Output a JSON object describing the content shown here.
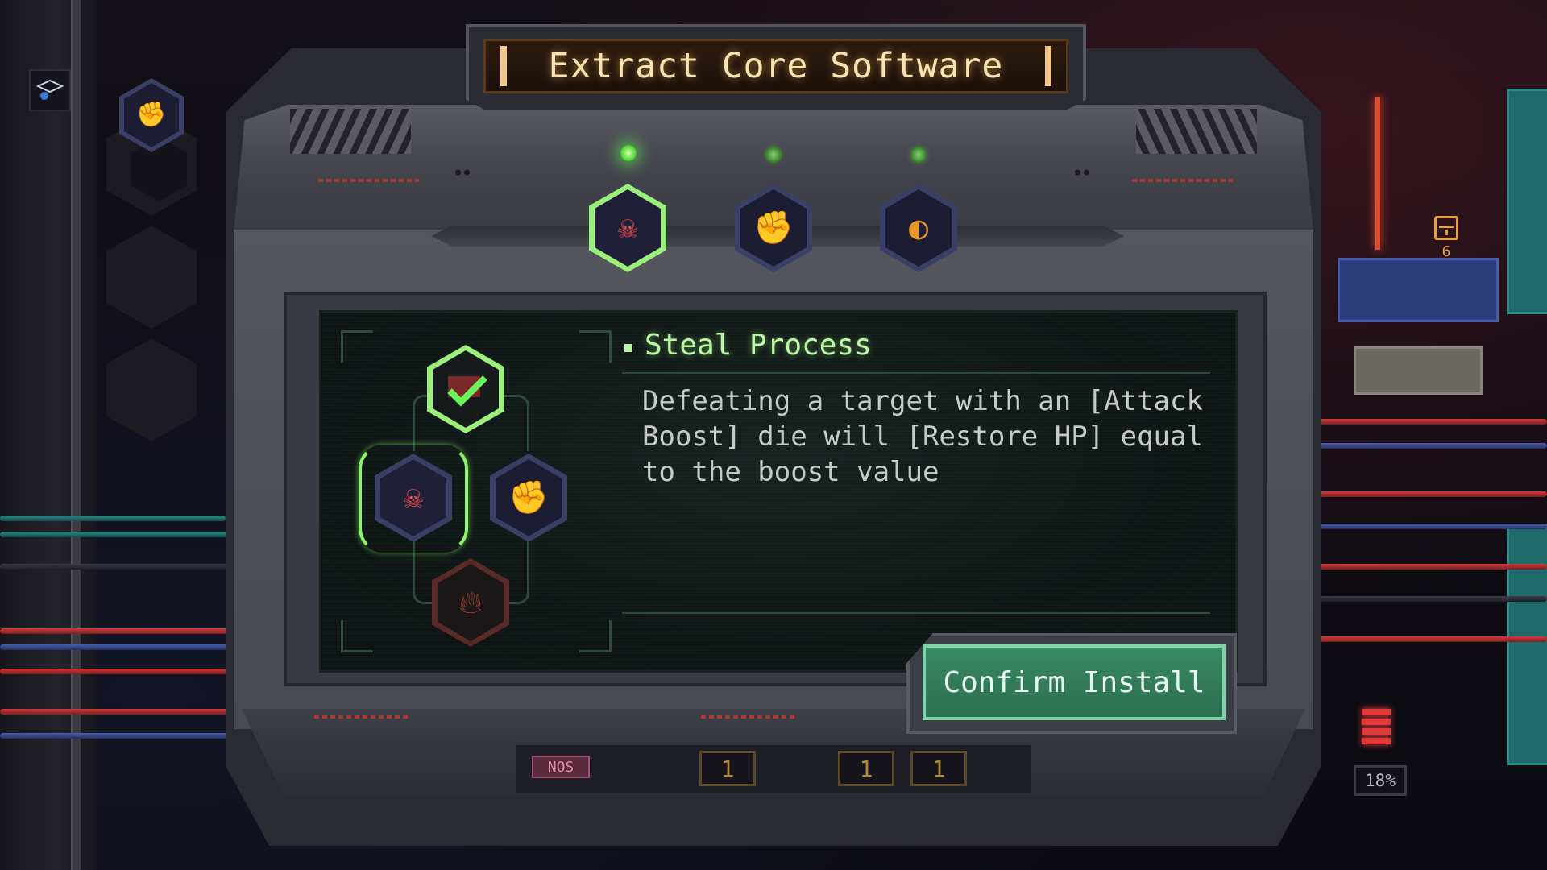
{
  "window": {
    "title": "Extract Core Software"
  },
  "software_slots": [
    {
      "icon": "brass-knuckles-icon",
      "selected": true,
      "led": "on"
    },
    {
      "icon": "fist-icon",
      "selected": false,
      "led": "dim"
    },
    {
      "icon": "mask-icon",
      "selected": false,
      "led": "dim"
    }
  ],
  "skill_tree": {
    "nodes": [
      {
        "id": "top",
        "icon": "check-icon",
        "state": "installed"
      },
      {
        "id": "left",
        "icon": "brass-knuckles-icon",
        "state": "selected"
      },
      {
        "id": "right",
        "icon": "fist-icon",
        "state": "available"
      },
      {
        "id": "bottom",
        "icon": "flame-icon",
        "state": "locked"
      }
    ]
  },
  "detail": {
    "name": "Steal Process",
    "description": "Defeating a target with an [Attack Boost] die will [Restore HP] equal to the boost value"
  },
  "actions": {
    "confirm_label": "Confirm Install"
  },
  "hud": {
    "percent_readout": "18%",
    "item_count": "6",
    "nos_label": "NOS",
    "die_values": [
      "1",
      "1",
      "1"
    ]
  },
  "colors": {
    "accent_green": "#8cf36a",
    "title_amber": "#f9e4b4",
    "button_green": "#2a6e50",
    "hex_red": "#e03a3a"
  }
}
